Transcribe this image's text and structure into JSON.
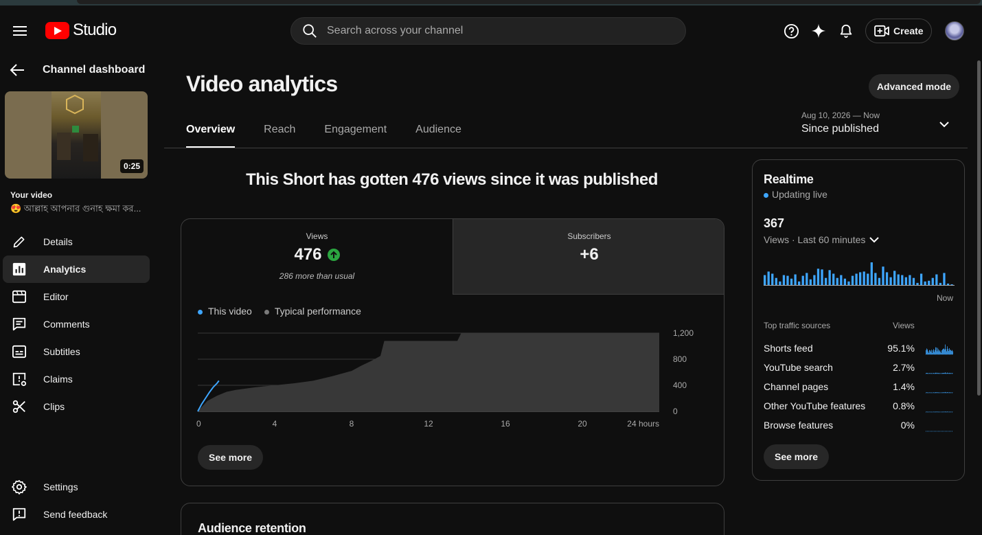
{
  "header": {
    "logo_text": "Studio",
    "search_placeholder": "Search across your channel",
    "create_label": "Create"
  },
  "sidebar": {
    "back_label": "Channel dashboard",
    "thumb_duration": "0:25",
    "your_video_label": "Your video",
    "video_title": "😍 আল্লাহ আপনার গুনাহ ক্ষমা কর...",
    "items": [
      {
        "label": "Details",
        "icon": "pencil-icon"
      },
      {
        "label": "Analytics",
        "icon": "analytics-icon"
      },
      {
        "label": "Editor",
        "icon": "editor-icon"
      },
      {
        "label": "Comments",
        "icon": "comments-icon"
      },
      {
        "label": "Subtitles",
        "icon": "subtitles-icon"
      },
      {
        "label": "Claims",
        "icon": "claims-icon"
      },
      {
        "label": "Clips",
        "icon": "scissors-icon"
      }
    ],
    "bottom_items": [
      {
        "label": "Settings",
        "icon": "gear-icon"
      },
      {
        "label": "Send feedback",
        "icon": "feedback-icon"
      }
    ],
    "active_item": "Analytics"
  },
  "main": {
    "title": "Video analytics",
    "advanced_mode_label": "Advanced mode",
    "tabs": [
      {
        "label": "Overview",
        "active": true
      },
      {
        "label": "Reach",
        "active": false
      },
      {
        "label": "Engagement",
        "active": false
      },
      {
        "label": "Audience",
        "active": false
      }
    ],
    "date_range": {
      "range_text": "Aug 10, 2026 — Now",
      "label": "Since published"
    },
    "headline": "This Short has gotten 476 views since it was published",
    "metrics": {
      "views": {
        "label": "Views",
        "value": "476",
        "note": "286 more than usual"
      },
      "subscribers": {
        "label": "Subscribers",
        "value": "+6"
      }
    },
    "legend": {
      "this_video": "This video",
      "typical": "Typical performance"
    },
    "see_more_label": "See more",
    "retention_title": "Audience retention"
  },
  "realtime": {
    "title": "Realtime",
    "status": "Updating live",
    "count": "367",
    "period": "Views · Last 60 minutes",
    "now_label": "Now",
    "traffic_header": "Top traffic sources",
    "views_header": "Views",
    "sources": [
      {
        "name": "Shorts feed",
        "percent": "95.1%",
        "spark_scale": 1.0
      },
      {
        "name": "YouTube search",
        "percent": "2.7%",
        "spark_scale": 0.12
      },
      {
        "name": "Channel pages",
        "percent": "1.4%",
        "spark_scale": 0.08
      },
      {
        "name": "Other YouTube features",
        "percent": "0.8%",
        "spark_scale": 0.05
      },
      {
        "name": "Browse features",
        "percent": "0%",
        "spark_scale": 0.0
      }
    ],
    "see_more_label": "See more",
    "bars": [
      14,
      19,
      16,
      10,
      5,
      14,
      13,
      9,
      15,
      5,
      13,
      17,
      8,
      14,
      23,
      22,
      10,
      21,
      16,
      10,
      14,
      9,
      5,
      13,
      16,
      18,
      19,
      16,
      32,
      17,
      10,
      26,
      18,
      11,
      20,
      15,
      14,
      11,
      14,
      10,
      3,
      16,
      5,
      6,
      10,
      15,
      3,
      17,
      2,
      1
    ]
  },
  "colors": {
    "accent_blue": "#3ea6ff",
    "up_green": "#2ba640",
    "brand_red": "#ff0000"
  },
  "chart_data": {
    "type": "area",
    "x_unit": "hours",
    "x_ticks": [
      "0",
      "4",
      "8",
      "12",
      "16",
      "20",
      "24 hours"
    ],
    "y_ticks": [
      "0",
      "400",
      "800",
      "1,200"
    ],
    "ylim": [
      0,
      1200
    ],
    "xlim": [
      0,
      24
    ],
    "series": [
      {
        "name": "This video",
        "color": "#3ea6ff",
        "x": [
          0,
          0.2,
          0.4,
          0.6,
          0.8,
          1.0,
          1.1
        ],
        "y": [
          0,
          110,
          200,
          290,
          370,
          430,
          470
        ]
      },
      {
        "name": "Typical performance",
        "color": "#383838",
        "x": [
          0,
          0.5,
          1,
          1.5,
          2,
          3,
          4,
          5,
          6,
          7,
          8,
          8.5,
          9,
          9.5,
          9.7,
          10,
          11,
          12,
          13,
          13.5,
          13.7,
          14,
          16,
          18,
          20,
          22,
          24
        ],
        "y": [
          0,
          160,
          240,
          300,
          330,
          370,
          400,
          430,
          470,
          540,
          620,
          700,
          770,
          850,
          1080,
          1080,
          1080,
          1080,
          1080,
          1080,
          1200,
          1200,
          1200,
          1200,
          1200,
          1200,
          1200
        ]
      }
    ]
  }
}
